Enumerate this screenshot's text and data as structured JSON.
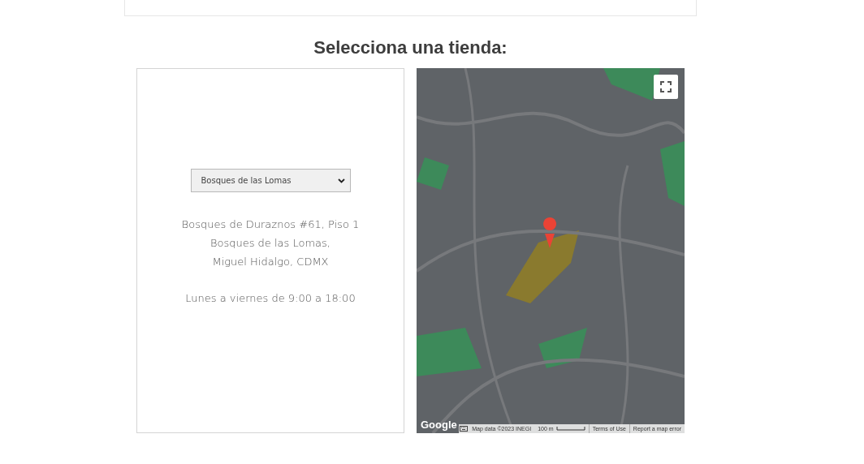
{
  "heading": "Selecciona una tienda:",
  "store_select": {
    "value": "Bosques de las Lomas"
  },
  "address_lines": [
    "Bosques de Duraznos #61, Piso 1",
    "Bosques de las Lomas,",
    "Miguel Hidalgo, CDMX"
  ],
  "hours": "Lunes a viernes de 9:00 a 18:00",
  "map": {
    "kind": "picture",
    "logo": "Google",
    "attribution": "Map data ©2023 INEGI",
    "scale": "100 m",
    "links": [
      "Terms of Use",
      "Report a map error"
    ]
  }
}
